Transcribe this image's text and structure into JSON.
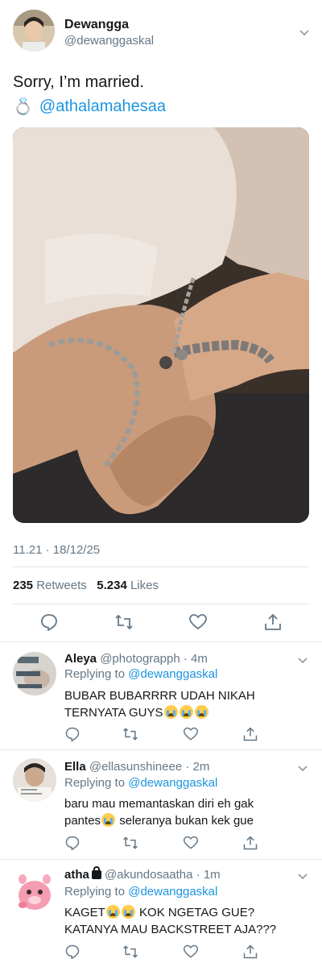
{
  "tweet": {
    "author_name": "Dewangga",
    "author_handle": "@dewanggaskal",
    "text": "Sorry, I’m married.",
    "ring_emoji": "💍",
    "mention": "@athalamahesaa",
    "timestamp": "11.21 · 18/12/25",
    "retweets_count": "235",
    "retweets_label": "Retweets",
    "likes_count": "5.234",
    "likes_label": "Likes"
  },
  "icons": {
    "reply": "reply-icon",
    "retweet": "retweet-icon",
    "like": "heart-icon",
    "share": "share-icon",
    "more": "chevron-down-icon"
  },
  "colors": {
    "link": "#1b95e0",
    "secondary_text": "#657786",
    "divider": "#e1e8ed"
  },
  "replies": [
    {
      "name": "Aleya",
      "meta": "@photograpph · 4m",
      "replying_label": "Replying to",
      "replying_to": "@dewanggaskal",
      "text_line1": "BUBAR BUBARRRR UDAH NIKAH",
      "text_line2": "TERNYATA GUYS",
      "emoji_count": 3
    },
    {
      "name": "Ella",
      "meta": "@ellasunshineee · 2m",
      "replying_label": "Replying to",
      "replying_to": "@dewanggaskal",
      "text_line1": "baru mau memantaskan diri eh gak",
      "text_line2a": "pantes",
      "text_line2b": " seleranya bukan kek gue"
    },
    {
      "name": "atha",
      "meta": "@akundosaatha · 1m",
      "replying_label": "Replying to",
      "replying_to": "@dewanggaskal",
      "text_line1a": "KAGET",
      "text_line1b": " KOK NGETAG GUE?",
      "text_line2": "KATANYA MAU BACKSTREET AJA???"
    }
  ]
}
